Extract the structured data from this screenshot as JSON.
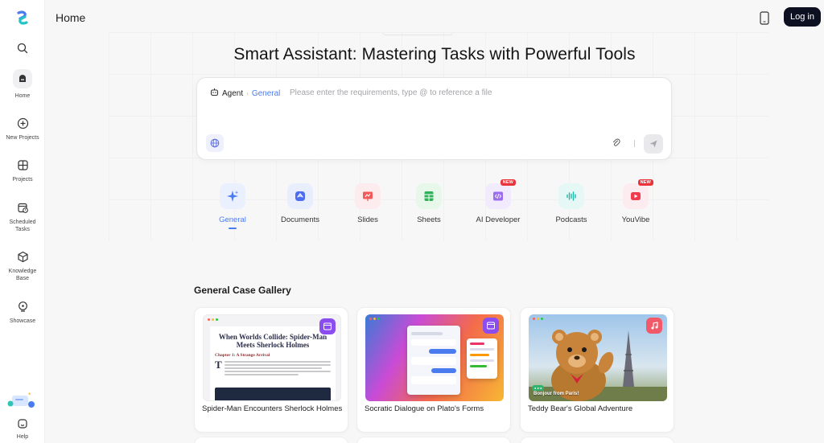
{
  "colors": {
    "accent": "#4a7cf0",
    "login_bg": "#0d1020",
    "new_badge": "#e8343a"
  },
  "sidebar": {
    "logo_icon": "app-logo-icon",
    "items": [
      {
        "id": "search",
        "label": "",
        "icon": "search-icon"
      },
      {
        "id": "home",
        "label": "Home",
        "icon": "home-icon"
      },
      {
        "id": "new-projects",
        "label": "New Projects",
        "icon": "plus-circle-icon"
      },
      {
        "id": "projects",
        "label": "Projects",
        "icon": "grid-icon"
      },
      {
        "id": "scheduled",
        "label": "Scheduled Tasks",
        "icon": "calendar-clock-icon"
      },
      {
        "id": "knowledge",
        "label": "Knowledge Base",
        "icon": "cube-icon"
      },
      {
        "id": "showcase",
        "label": "Showcase",
        "icon": "lightbulb-icon"
      },
      {
        "id": "help",
        "label": "Help",
        "icon": "help-icon"
      }
    ]
  },
  "header": {
    "title": "Home",
    "login_label": "Log in"
  },
  "hero": {
    "title": "Smart Assistant: Mastering Tasks with Powerful Tools"
  },
  "prompt": {
    "agent_label": "Agent",
    "mode_label": "General",
    "placeholder": "Please enter the requirements, type @ to reference a file",
    "value": ""
  },
  "categories": [
    {
      "label": "General",
      "active": true,
      "badge": ""
    },
    {
      "label": "Documents",
      "active": false,
      "badge": ""
    },
    {
      "label": "Slides",
      "active": false,
      "badge": ""
    },
    {
      "label": "Sheets",
      "active": false,
      "badge": ""
    },
    {
      "label": "AI Developer",
      "active": false,
      "badge": "NEW"
    },
    {
      "label": "Podcasts",
      "active": false,
      "badge": ""
    },
    {
      "label": "YouVibe",
      "active": false,
      "badge": "NEW"
    }
  ],
  "gallery": {
    "title": "General Case Gallery",
    "cards": [
      {
        "title": "Spider-Man Encounters Sherlock Holmes",
        "thumb_heading": "When Worlds Collide: Spider-Man Meets Sherlock Holmes",
        "thumb_chapter": "Chapter 1: A Strange Arrival",
        "thumb_dropcap": "T"
      },
      {
        "title": "Socratic Dialogue on Plato's Forms"
      },
      {
        "title": "Teddy Bear's Global Adventure",
        "thumb_caption": "Bonjour from Paris!"
      }
    ]
  }
}
